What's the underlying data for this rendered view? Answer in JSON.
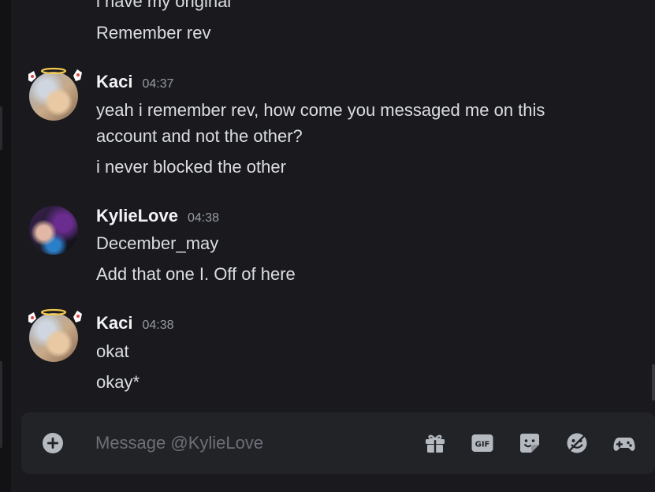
{
  "messages": {
    "top_partial_line": "i have my original",
    "top_line": "Remember rev",
    "group1": {
      "username": "Kaci",
      "time": "04:37",
      "line1": "yeah i remember rev, how come you messaged me on this",
      "line2": "account and not the other?",
      "line3": "i never blocked the other"
    },
    "group2": {
      "username": "KylieLove",
      "time": "04:38",
      "line1": "December_may",
      "line2": "Add that one I. Off of here"
    },
    "group3": {
      "username": "Kaci",
      "time": "04:38",
      "line1": "okat",
      "line2": "okay*"
    }
  },
  "composer": {
    "placeholder": "Message @KylieLove",
    "gif_label": "GIF"
  },
  "icons": {
    "attach": "plus-circle-icon",
    "gift": "gift-icon",
    "gif": "gif-icon",
    "sticker": "sticker-icon",
    "emoji": "emoji-icon",
    "activity": "gamepad-icon"
  },
  "colors": {
    "background": "#1a1a1e",
    "text": "#dbdee1",
    "username": "#f2f3f5",
    "timestamp": "#949ba4",
    "composer": "#222327",
    "icon": "#b5bac1"
  }
}
